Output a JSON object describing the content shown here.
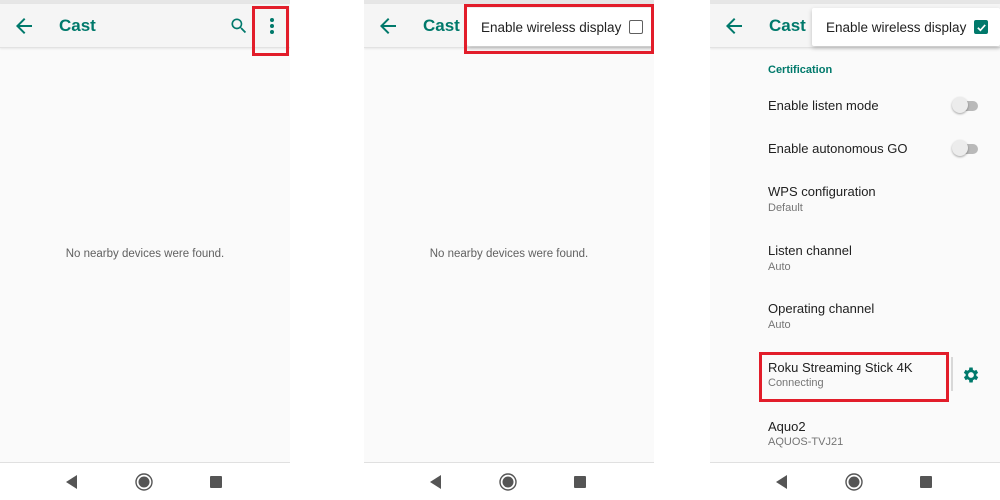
{
  "accent_color": "#00796b",
  "highlight_color": "#e21d2a",
  "panels": [
    {
      "appbar": {
        "title": "Cast",
        "back_icon": "arrow-back-icon",
        "search_icon": "search-icon",
        "overflow_icon": "more-vert-icon"
      },
      "empty_message": "No nearby devices were found.",
      "highlighted": "overflow-menu-button"
    },
    {
      "appbar": {
        "title": "Cast",
        "back_icon": "arrow-back-icon"
      },
      "popup": {
        "label": "Enable wireless display",
        "checked": false
      },
      "empty_message": "No nearby devices were found.",
      "highlighted": "enable-wireless-display-menu-item"
    },
    {
      "appbar": {
        "title": "Cast",
        "back_icon": "arrow-back-icon"
      },
      "popup": {
        "label": "Enable wireless display",
        "checked": true
      },
      "section_header": "Certification",
      "preferences": [
        {
          "title": "Enable listen mode",
          "type": "switch",
          "on": false
        },
        {
          "title": "Enable autonomous GO",
          "type": "switch",
          "on": false
        },
        {
          "title": "WPS configuration",
          "summary": "Default"
        },
        {
          "title": "Listen channel",
          "summary": "Auto"
        },
        {
          "title": "Operating channel",
          "summary": "Auto"
        }
      ],
      "devices": [
        {
          "name": "Roku Streaming Stick 4K",
          "status": "Connecting",
          "settings_icon": "gear-icon",
          "highlighted": true
        },
        {
          "name": "Aquo2",
          "status": "AQUOS-TVJ21"
        }
      ]
    }
  ],
  "navbar": {
    "back_icon": "nav-back-icon",
    "home_icon": "nav-home-icon",
    "recents_icon": "nav-recents-icon"
  }
}
